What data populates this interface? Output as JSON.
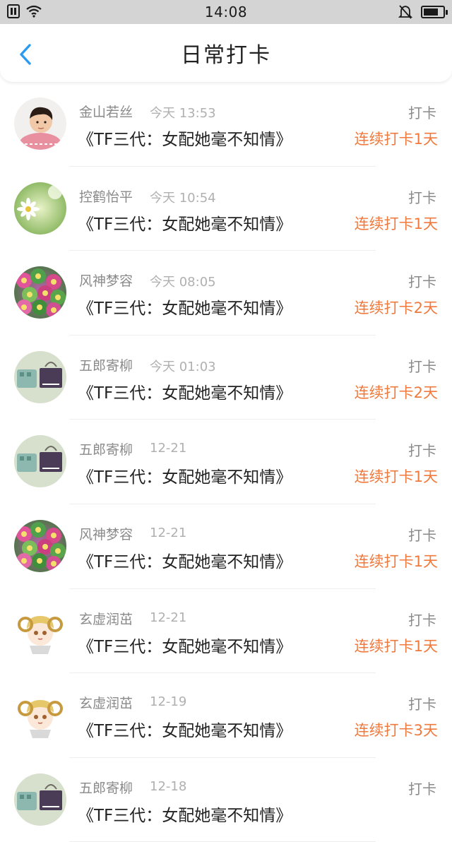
{
  "status_bar": {
    "time": "14:08",
    "battery_level": 0.75
  },
  "header": {
    "title": "日常打卡"
  },
  "items": [
    {
      "user": "金山若丝",
      "time": "今天 13:53",
      "book": "《TF三代：女配她毫不知情》",
      "action": "打卡",
      "streak": "连续打卡1天",
      "avatar": "boy-portrait"
    },
    {
      "user": "控鹤怡平",
      "time": "今天 10:54",
      "book": "《TF三代：女配她毫不知情》",
      "action": "打卡",
      "streak": "连续打卡1天",
      "avatar": "daisy-flower"
    },
    {
      "user": "风神梦容",
      "time": "今天 08:05",
      "book": "《TF三代：女配她毫不知情》",
      "action": "打卡",
      "streak": "连续打卡2天",
      "avatar": "cactus"
    },
    {
      "user": "五郎寄柳",
      "time": "今天 01:03",
      "book": "《TF三代：女配她毫不知情》",
      "action": "打卡",
      "streak": "连续打卡2天",
      "avatar": "bags"
    },
    {
      "user": "五郎寄柳",
      "time": "12-21",
      "book": "《TF三代：女配她毫不知情》",
      "action": "打卡",
      "streak": "连续打卡1天",
      "avatar": "bags"
    },
    {
      "user": "风神梦容",
      "time": "12-21",
      "book": "《TF三代：女配她毫不知情》",
      "action": "打卡",
      "streak": "连续打卡1天",
      "avatar": "cactus"
    },
    {
      "user": "玄虚润茁",
      "time": "12-21",
      "book": "《TF三代：女配她毫不知情》",
      "action": "打卡",
      "streak": "连续打卡1天",
      "avatar": "anime-ram"
    },
    {
      "user": "玄虚润茁",
      "time": "12-19",
      "book": "《TF三代：女配她毫不知情》",
      "action": "打卡",
      "streak": "连续打卡3天",
      "avatar": "anime-ram"
    },
    {
      "user": "五郎寄柳",
      "time": "12-18",
      "book": "《TF三代：女配她毫不知情》",
      "action": "打卡",
      "streak": "",
      "avatar": "bags"
    }
  ]
}
